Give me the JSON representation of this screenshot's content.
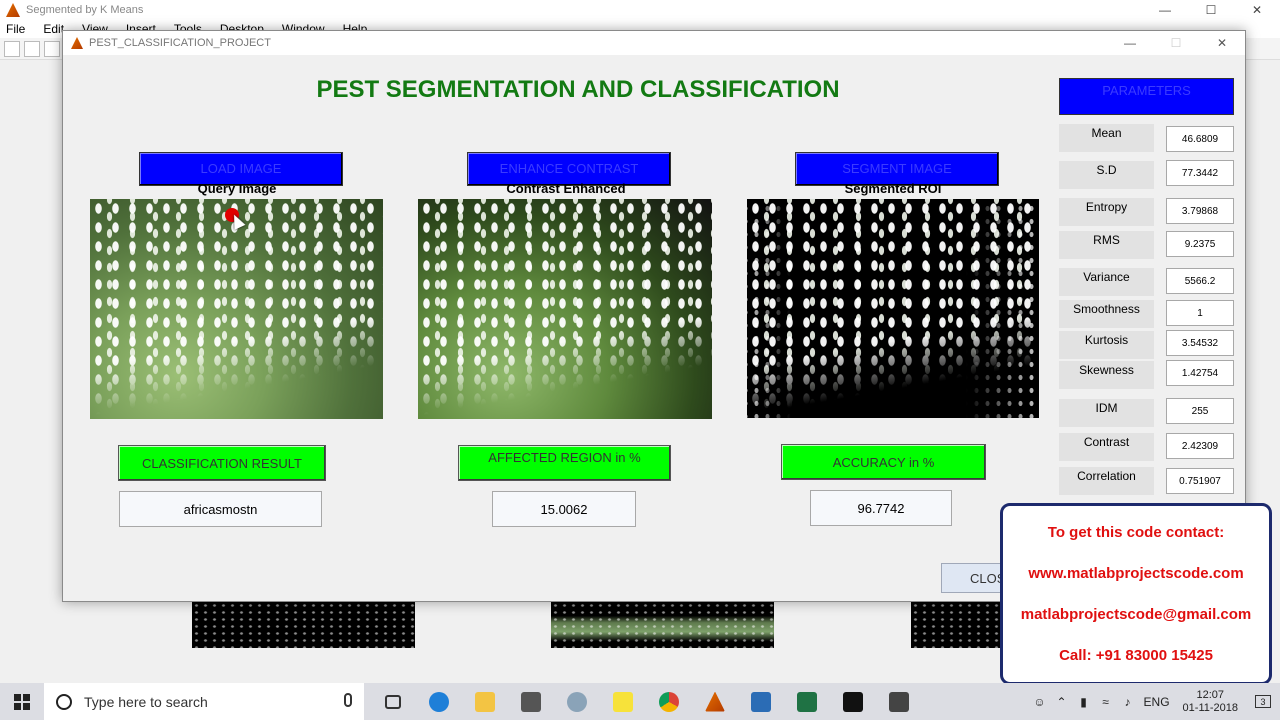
{
  "bg_window": {
    "title": "Segmented by K Means",
    "menu": [
      "File",
      "Edit",
      "View",
      "Insert",
      "Tools",
      "Desktop",
      "Window",
      "Help"
    ]
  },
  "gui": {
    "window_title": "PEST_CLASSIFICATION_PROJECT",
    "main_title": "PEST SEGMENTATION AND CLASSIFICATION",
    "load_button": "LOAD IMAGE",
    "enhance_button": "ENHANCE CONTRAST",
    "segment_button": "SEGMENT IMAGE",
    "query_label": "Query Image",
    "enhanced_label": "Contrast Enhanced",
    "segmented_label": "Segmented ROI",
    "classification_button": "CLASSIFICATION RESULT",
    "affected_button": "AFFECTED REGION in %",
    "accuracy_button": "ACCURACY in %",
    "classification_value": "africasmostn",
    "affected_value": "15.0062",
    "accuracy_value": "96.7742",
    "close_button": "CLOSE"
  },
  "parameters": {
    "header": "PARAMETERS",
    "items": [
      {
        "label": "Mean",
        "value": "46.6809"
      },
      {
        "label": "S.D",
        "value": "77.3442"
      },
      {
        "label": "Entropy",
        "value": "3.79868"
      },
      {
        "label": "RMS",
        "value": "9.2375"
      },
      {
        "label": "Variance",
        "value": "5566.2"
      },
      {
        "label": "Smoothness",
        "value": "1"
      },
      {
        "label": "Kurtosis",
        "value": "3.54532"
      },
      {
        "label": "Skewness",
        "value": "1.42754"
      },
      {
        "label": "IDM",
        "value": "255"
      },
      {
        "label": "Contrast",
        "value": "2.42309"
      },
      {
        "label": "Correlation",
        "value": "0.751907"
      }
    ]
  },
  "contact": {
    "line1": "To get this code contact:",
    "line2": "www.matlabprojectscode.com",
    "line3": "matlabprojectscode@gmail.com",
    "line4": "Call: +91 83000 15425"
  },
  "taskbar": {
    "search_placeholder": "Type here to search",
    "language": "ENG",
    "time": "12:07",
    "date": "01-11-2018",
    "notification_count": "3"
  },
  "colors": {
    "title_green": "#137a13",
    "button_blue": "#0000ff",
    "button_green": "#00ff00",
    "contact_red": "#e01010"
  }
}
